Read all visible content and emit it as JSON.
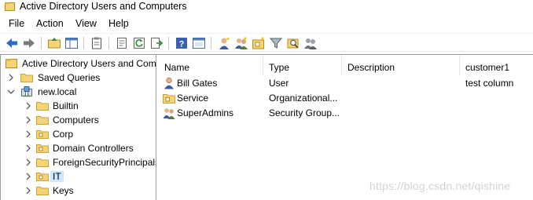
{
  "window": {
    "title": "Active Directory Users and Computers"
  },
  "menu": [
    "File",
    "Action",
    "View",
    "Help"
  ],
  "toolbar": {
    "buttons": [
      "back-icon",
      "forward-icon",
      "up-folder-icon",
      "show-hide-console-tree-icon",
      "clipboard-icon",
      "properties-icon",
      "refresh-icon",
      "export-list-icon",
      "help-icon",
      "console-icon",
      "new-user-icon",
      "new-group-icon",
      "new-ou-icon",
      "filter-icon",
      "find-icon",
      "add-to-group-icon"
    ]
  },
  "tree": {
    "root": "Active Directory Users and Com",
    "items": [
      {
        "label": "Saved Queries",
        "expander": ">"
      },
      {
        "label": "new.local",
        "expander": "v"
      },
      {
        "label": "Builtin",
        "expander": ">"
      },
      {
        "label": "Computers",
        "expander": ">"
      },
      {
        "label": "Corp",
        "expander": ">"
      },
      {
        "label": "Domain Controllers",
        "expander": ">"
      },
      {
        "label": "ForeignSecurityPrincipals",
        "expander": ">"
      },
      {
        "label": "IT",
        "expander": ">"
      },
      {
        "label": "Keys",
        "expander": ">"
      }
    ]
  },
  "list": {
    "columns": [
      "Name",
      "Type",
      "Description",
      "customer1"
    ],
    "rows": [
      {
        "name": "Bill Gates",
        "type": "User",
        "description": "",
        "customer1": "test column",
        "icon": "user-icon"
      },
      {
        "name": "Service",
        "type": "Organizational...",
        "description": "",
        "customer1": "",
        "icon": "ou-icon"
      },
      {
        "name": "SuperAdmins",
        "type": "Security Group...",
        "description": "",
        "customer1": "",
        "icon": "group-icon"
      }
    ]
  },
  "watermark": "https://blog.csdn.net/qishine",
  "colors": {
    "selection": "#cce8ff",
    "folder": "#f5d476",
    "accent_blue": "#2b6cc4"
  }
}
